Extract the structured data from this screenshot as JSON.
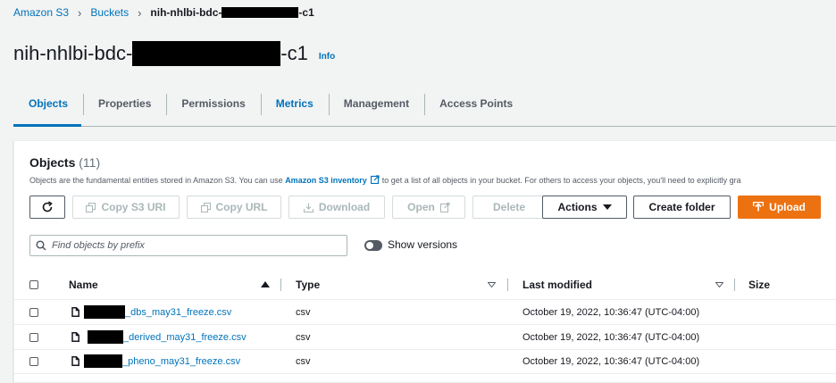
{
  "breadcrumb": {
    "items": [
      "Amazon S3",
      "Buckets"
    ],
    "current_prefix": "nih-nhlbi-bdc-",
    "current_suffix": "-c1"
  },
  "page": {
    "title_prefix": "nih-nhlbi-bdc-",
    "title_suffix": "-c1",
    "info": "Info"
  },
  "tabs": [
    "Objects",
    "Properties",
    "Permissions",
    "Metrics",
    "Management",
    "Access Points"
  ],
  "objects": {
    "heading": "Objects",
    "count": "(11)",
    "desc_before": "Objects are the fundamental entities stored in Amazon S3. You can use ",
    "desc_link": "Amazon S3 inventory",
    "desc_after": " to get a list of all objects in your bucket. For others to access your objects, you'll need to explicitly gra"
  },
  "toolbar": {
    "copy_uri": "Copy S3 URI",
    "copy_url": "Copy URL",
    "download": "Download",
    "open": "Open",
    "delete": "Delete",
    "actions": "Actions",
    "create_folder": "Create folder",
    "upload": "Upload"
  },
  "search": {
    "placeholder": "Find objects by prefix"
  },
  "versions_label": "Show versions",
  "table": {
    "headers": {
      "name": "Name",
      "type": "Type",
      "modified": "Last modified",
      "size": "Size"
    },
    "rows": [
      {
        "name": "_dbs_may31_freeze.csv",
        "type": "csv",
        "modified": "October 19, 2022, 10:36:47 (UTC-04:00)"
      },
      {
        "name": "_derived_may31_freeze.csv",
        "type": "csv",
        "modified": "October 19, 2022, 10:36:47 (UTC-04:00)"
      },
      {
        "name": "_pheno_may31_freeze.csv",
        "type": "csv",
        "modified": "October 19, 2022, 10:36:47 (UTC-04:00)"
      }
    ]
  }
}
